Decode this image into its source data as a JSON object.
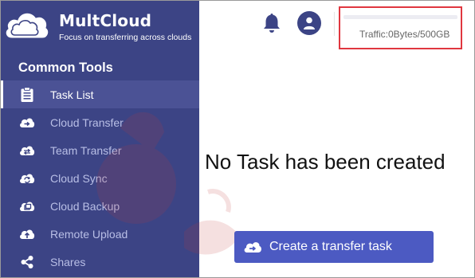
{
  "brand": {
    "name": "MultCloud",
    "tagline": "Focus on transferring across clouds"
  },
  "sidebar": {
    "section_title": "Common Tools",
    "items": [
      {
        "label": "Task List",
        "icon": "clipboard-icon",
        "active": true
      },
      {
        "label": "Cloud Transfer",
        "icon": "cloud-transfer-icon",
        "active": false
      },
      {
        "label": "Team Transfer",
        "icon": "team-transfer-icon",
        "active": false
      },
      {
        "label": "Cloud Sync",
        "icon": "cloud-sync-icon",
        "active": false
      },
      {
        "label": "Cloud Backup",
        "icon": "cloud-backup-icon",
        "active": false
      },
      {
        "label": "Remote Upload",
        "icon": "remote-upload-icon",
        "active": false
      },
      {
        "label": "Shares",
        "icon": "share-icon",
        "active": false
      }
    ]
  },
  "header": {
    "traffic_text": "Traffic:0Bytes/500GB",
    "traffic_used_fraction": 0
  },
  "main": {
    "empty_message": "No Task has been created",
    "create_button_label": "Create a transfer task"
  },
  "colors": {
    "sidebar_bg": "#3c4485",
    "accent_button": "#4c5ac2",
    "highlight_border": "#e0373f"
  }
}
